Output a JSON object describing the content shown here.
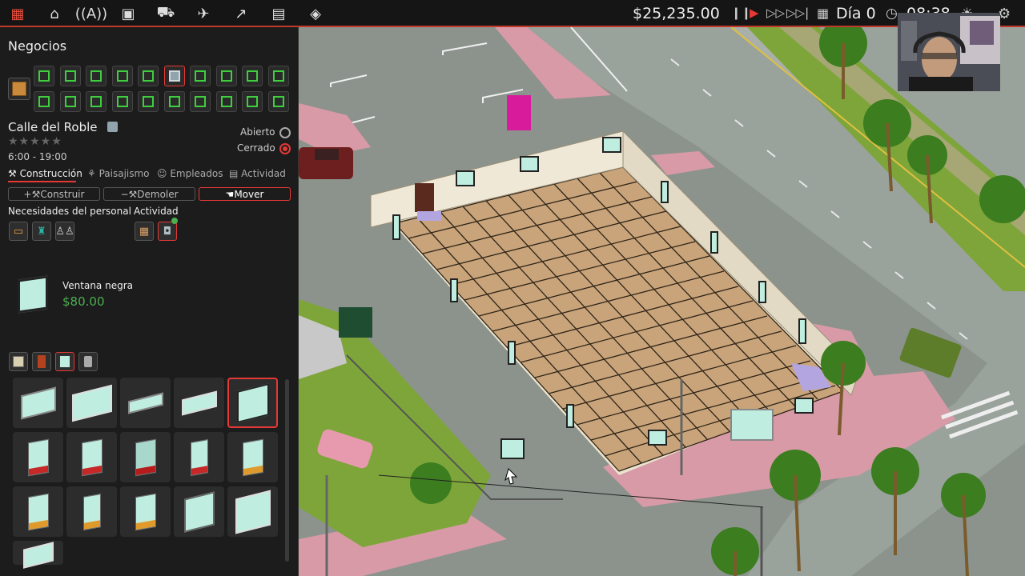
{
  "topbar": {
    "icons": [
      "building-icon",
      "tag-icon",
      "radio-icon",
      "briefcase-icon",
      "truck-icon",
      "plane-icon",
      "chart-icon",
      "news-icon",
      "layers-icon"
    ],
    "money": "$25,235.00",
    "day": "Día 0",
    "time": "08:38"
  },
  "panel": {
    "title": "Negocios",
    "business_name": "Calle del Roble",
    "hours": "6:00 - 19:00",
    "open_label": "Abierto",
    "closed_label": "Cerrado",
    "status": "closed",
    "rating": 0,
    "tabs": [
      "Construcción",
      "Paisajismo",
      "Empleados",
      "Actividad"
    ],
    "active_tab": "Construcción",
    "actions": [
      "Construir",
      "Demoler",
      "Mover"
    ],
    "active_action": "Mover",
    "needs_label": "Necesidades del personal",
    "activity_label": "Actividad",
    "selected_item": {
      "name": "Ventana negra",
      "price": "$80.00"
    }
  },
  "colors": {
    "accent": "#e53935",
    "money_green": "#4caf50",
    "grid_green": "#3ecf3e",
    "glass": "#bfeee0"
  }
}
